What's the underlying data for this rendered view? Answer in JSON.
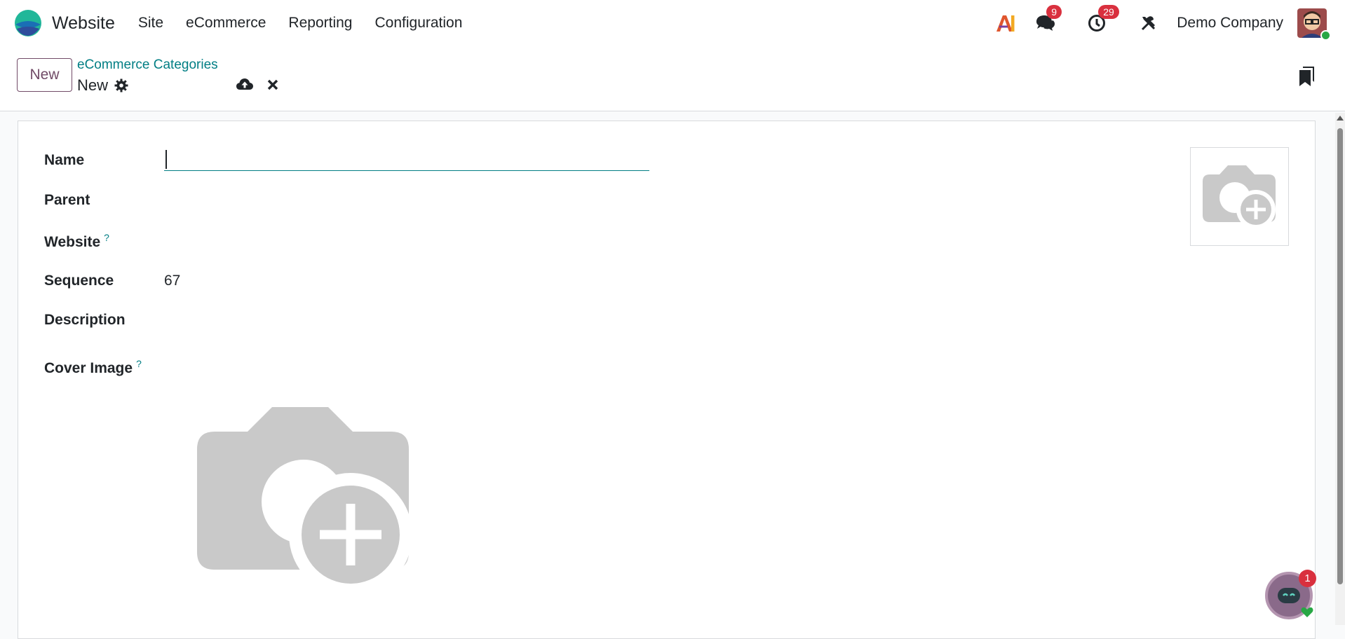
{
  "app": {
    "name": "Website",
    "logo_icon": "odoo-website-logo-icon"
  },
  "menu": {
    "items": [
      "Site",
      "eCommerce",
      "Reporting",
      "Configuration"
    ]
  },
  "systray": {
    "ai_icon": "ai-icon",
    "messages_count": "9",
    "activities_count": "29",
    "debug_icon": "tools-icon",
    "company": "Demo Company"
  },
  "control": {
    "new_label": "New",
    "breadcrumb": "eCommerce Categories",
    "record_name": "New"
  },
  "form": {
    "labels": {
      "name": "Name",
      "parent": "Parent",
      "website": "Website",
      "sequence": "Sequence",
      "description": "Description",
      "cover_image": "Cover Image"
    },
    "help_mark": "?",
    "name_value": "",
    "sequence_value": "67"
  },
  "chat": {
    "badge_count": "1"
  },
  "colors": {
    "accent": "#017e84",
    "brand": "#714b67",
    "badge": "#d9303e"
  }
}
